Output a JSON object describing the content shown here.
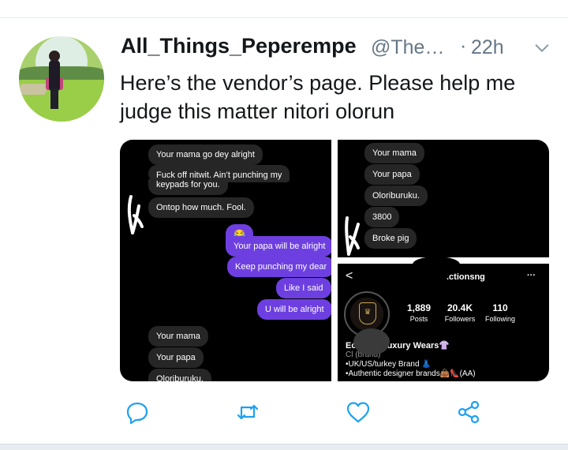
{
  "tweet": {
    "display_name": "All_Things_Peperempe",
    "handle": "@The…",
    "separator": "·",
    "time": "22h",
    "text": "Here’s the vendor’s page. Please help me judge this matter nitori olorun"
  },
  "media": {
    "left_chat": {
      "messages": [
        {
          "dir": "in",
          "text": "Your mama go dey alright"
        },
        {
          "dir": "in",
          "text": "Fuck off nitwit. Ain’t punching my"
        },
        {
          "dir": "in",
          "text": "keypads for you."
        },
        {
          "dir": "in",
          "text": "Ontop how much. Fool."
        },
        {
          "dir": "out",
          "text": "😂"
        },
        {
          "dir": "out",
          "text": "Your papa will be alright"
        },
        {
          "dir": "out",
          "text": "Keep punching my dear"
        },
        {
          "dir": "out",
          "text": "Like I said"
        },
        {
          "dir": "out",
          "text": "U will be alright"
        },
        {
          "dir": "in",
          "text": "Your mama"
        },
        {
          "dir": "in",
          "text": "Your papa"
        },
        {
          "dir": "in",
          "text": "Oloriburuku."
        }
      ]
    },
    "right_chat": {
      "messages": [
        {
          "dir": "in",
          "text": "Your mama"
        },
        {
          "dir": "in",
          "text": "Your papa"
        },
        {
          "dir": "in",
          "text": "Oloriburuku."
        },
        {
          "dir": "in",
          "text": "3800"
        },
        {
          "dir": "in",
          "text": "Broke pig"
        }
      ]
    },
    "profile": {
      "back": "<",
      "username": ".ctionsng",
      "more": "···",
      "stats": [
        {
          "value": "1,889",
          "label": "Posts"
        },
        {
          "value": "20.4K",
          "label": "Followers"
        },
        {
          "value": "110",
          "label": "Following"
        }
      ],
      "bio": [
        "Ec         ssic&Luxury Wears👚",
        "Cl         (brand)",
        "•UK/US/turkey Brand 👗",
        "•Authentic designer brands👜👠(AA)"
      ]
    }
  },
  "actions": {
    "reply": "reply-icon",
    "retweet": "retweet-icon",
    "like": "heart-icon",
    "share": "share-icon"
  },
  "colors": {
    "accent": "#1da1f2",
    "icon_gray": "#657786",
    "outgoing_bubble": "#6e3fe0",
    "incoming_bubble": "#262626"
  }
}
